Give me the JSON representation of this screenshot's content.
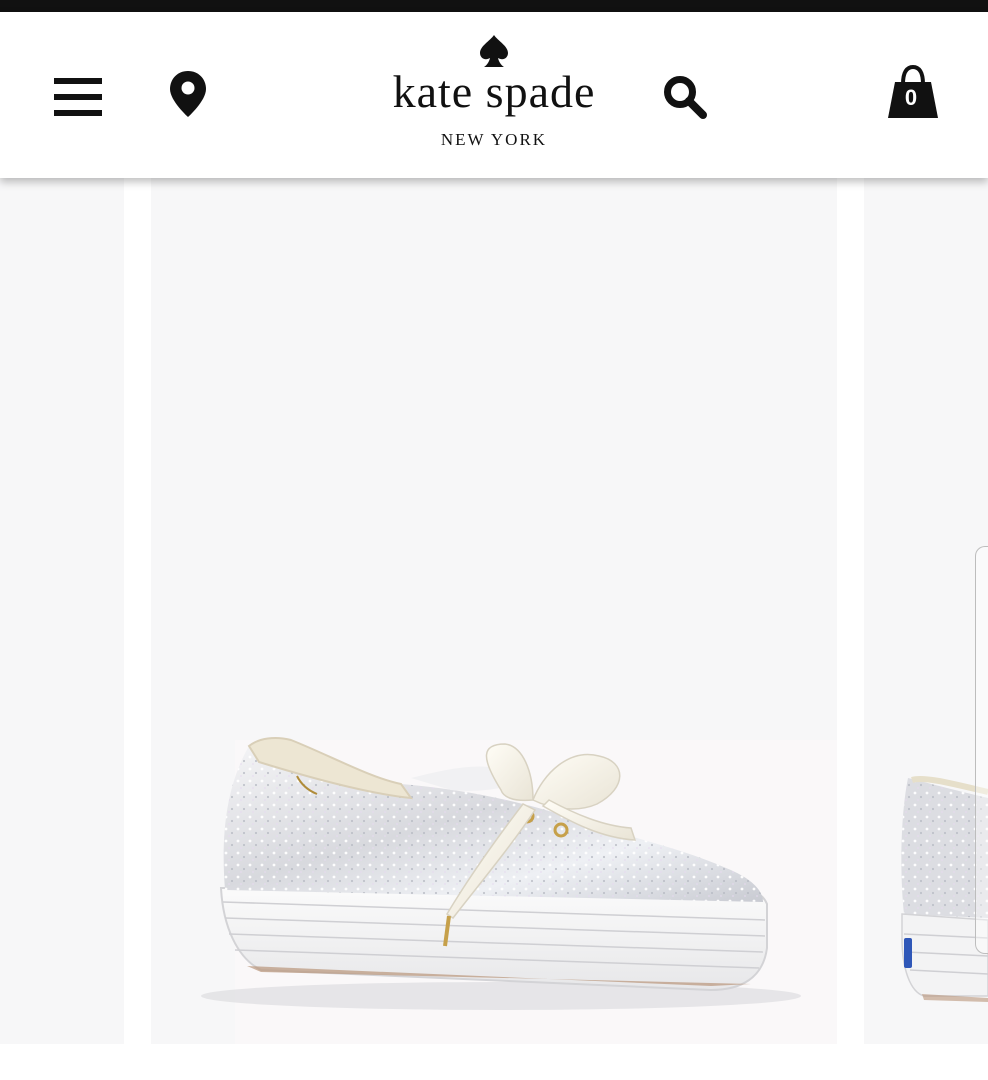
{
  "header": {
    "brand_name": "kate spade",
    "brand_tagline": "NEW YORK",
    "cart_count": "0",
    "icons": {
      "menu": "hamburger-menu-icon",
      "location": "map-pin-icon",
      "search": "magnifier-icon",
      "cart": "shopping-bag-icon",
      "logo": "spade-icon"
    }
  },
  "product_gallery": {
    "current_image": "glitter lace-up platform sneaker with satin ribbon laces",
    "colors": {
      "background": "#f7f7f8",
      "header_icon": "#111111"
    }
  }
}
